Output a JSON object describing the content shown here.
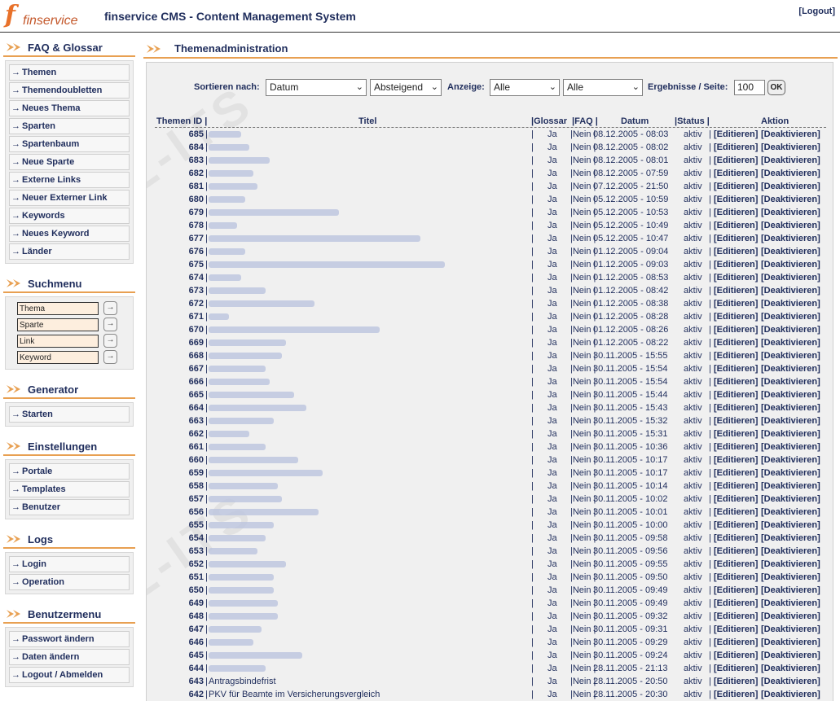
{
  "header": {
    "logo_mark": "f",
    "logo_text": "finservice",
    "app_title": "finservice CMS - Content Management System",
    "logout_label": "[Logout]"
  },
  "sidebar": {
    "faq": {
      "title": "FAQ & Glossar",
      "items": [
        "Themen",
        "Themendoubletten",
        "Neues Thema",
        "Sparten",
        "Spartenbaum",
        "Neue Sparte",
        "Externe Links",
        "Neuer Externer Link",
        "Keywords",
        "Neues Keyword",
        "Länder"
      ]
    },
    "search": {
      "title": "Suchmenu",
      "fields": [
        "Thema",
        "Sparte",
        "Link",
        "Keyword"
      ],
      "go_label": "→"
    },
    "generator": {
      "title": "Generator",
      "items": [
        "Starten"
      ]
    },
    "settings": {
      "title": "Einstellungen",
      "items": [
        "Portale",
        "Templates",
        "Benutzer"
      ]
    },
    "logs": {
      "title": "Logs",
      "items": [
        "Login",
        "Operation"
      ]
    },
    "user": {
      "title": "Benutzermenu",
      "items": [
        "Passwort ändern",
        "Daten ändern",
        "Logout / Abmelden"
      ]
    }
  },
  "main": {
    "title": "Themenadministration",
    "filter": {
      "sort_label": "Sortieren nach:",
      "sort_value": "Datum",
      "order_value": "Absteigend",
      "display_label": "Anzeige:",
      "display_value_1": "Alle",
      "display_value_2": "Alle",
      "results_label": "Ergebnisse / Seite:",
      "results_value": "100",
      "ok_label": "OK"
    },
    "columns": {
      "id": "Themen ID |",
      "title": "Titel",
      "glossar": "|Glossar",
      "faq": "|FAQ |",
      "datum": "Datum",
      "status": "|Status |",
      "aktion": "Aktion"
    },
    "rows": [
      {
        "id": "685",
        "title": "",
        "glossar": "Ja",
        "datum": "08.12.2005 - 08:03",
        "status": "aktiv"
      },
      {
        "id": "684",
        "title": "",
        "glossar": "Ja",
        "datum": "08.12.2005 - 08:02",
        "status": "aktiv"
      },
      {
        "id": "683",
        "title": "",
        "glossar": "Ja",
        "datum": "08.12.2005 - 08:01",
        "status": "aktiv"
      },
      {
        "id": "682",
        "title": "",
        "glossar": "Ja",
        "datum": "08.12.2005 - 07:59",
        "status": "aktiv"
      },
      {
        "id": "681",
        "title": "",
        "glossar": "Ja",
        "datum": "07.12.2005 - 21:50",
        "status": "aktiv"
      },
      {
        "id": "680",
        "title": "",
        "glossar": "Ja",
        "datum": "05.12.2005 - 10:59",
        "status": "aktiv"
      },
      {
        "id": "679",
        "title": "",
        "glossar": "Ja",
        "datum": "05.12.2005 - 10:53",
        "status": "aktiv"
      },
      {
        "id": "678",
        "title": "",
        "glossar": "Ja",
        "datum": "05.12.2005 - 10:49",
        "status": "aktiv"
      },
      {
        "id": "677",
        "title": "",
        "glossar": "Ja",
        "datum": "05.12.2005 - 10:47",
        "status": "aktiv"
      },
      {
        "id": "676",
        "title": "",
        "glossar": "Ja",
        "datum": "01.12.2005 - 09:04",
        "status": "aktiv"
      },
      {
        "id": "675",
        "title": "",
        "glossar": "Ja",
        "datum": "01.12.2005 - 09:03",
        "status": "aktiv"
      },
      {
        "id": "674",
        "title": "",
        "glossar": "Ja",
        "datum": "01.12.2005 - 08:53",
        "status": "aktiv"
      },
      {
        "id": "673",
        "title": "",
        "glossar": "Ja",
        "datum": "01.12.2005 - 08:42",
        "status": "aktiv"
      },
      {
        "id": "672",
        "title": "",
        "glossar": "Ja",
        "datum": "01.12.2005 - 08:38",
        "status": "aktiv"
      },
      {
        "id": "671",
        "title": "",
        "glossar": "Ja",
        "datum": "01.12.2005 - 08:28",
        "status": "aktiv"
      },
      {
        "id": "670",
        "title": "",
        "glossar": "Ja",
        "datum": "01.12.2005 - 08:26",
        "status": "aktiv"
      },
      {
        "id": "669",
        "title": "",
        "glossar": "Ja",
        "datum": "01.12.2005 - 08:22",
        "status": "aktiv"
      },
      {
        "id": "668",
        "title": "",
        "glossar": "Ja",
        "datum": "30.11.2005 - 15:55",
        "status": "aktiv"
      },
      {
        "id": "667",
        "title": "",
        "glossar": "Ja",
        "datum": "30.11.2005 - 15:54",
        "status": "aktiv"
      },
      {
        "id": "666",
        "title": "",
        "glossar": "Ja",
        "datum": "30.11.2005 - 15:54",
        "status": "aktiv"
      },
      {
        "id": "665",
        "title": "",
        "glossar": "Ja",
        "datum": "30.11.2005 - 15:44",
        "status": "aktiv"
      },
      {
        "id": "664",
        "title": "",
        "glossar": "Ja",
        "datum": "30.11.2005 - 15:43",
        "status": "aktiv"
      },
      {
        "id": "663",
        "title": "",
        "glossar": "Ja",
        "datum": "30.11.2005 - 15:32",
        "status": "aktiv"
      },
      {
        "id": "662",
        "title": "",
        "glossar": "Ja",
        "datum": "30.11.2005 - 15:31",
        "status": "aktiv"
      },
      {
        "id": "661",
        "title": "",
        "glossar": "Ja",
        "datum": "30.11.2005 - 10:36",
        "status": "aktiv"
      },
      {
        "id": "660",
        "title": "",
        "glossar": "Ja",
        "datum": "30.11.2005 - 10:17",
        "status": "aktiv"
      },
      {
        "id": "659",
        "title": "",
        "glossar": "Ja",
        "datum": "30.11.2005 - 10:17",
        "status": "aktiv"
      },
      {
        "id": "658",
        "title": "",
        "glossar": "Ja",
        "datum": "30.11.2005 - 10:14",
        "status": "aktiv"
      },
      {
        "id": "657",
        "title": "",
        "glossar": "Ja",
        "datum": "30.11.2005 - 10:02",
        "status": "aktiv"
      },
      {
        "id": "656",
        "title": "",
        "glossar": "Ja",
        "datum": "30.11.2005 - 10:01",
        "status": "aktiv"
      },
      {
        "id": "655",
        "title": "",
        "glossar": "Ja",
        "datum": "30.11.2005 - 10:00",
        "status": "aktiv"
      },
      {
        "id": "654",
        "title": "",
        "glossar": "Ja",
        "datum": "30.11.2005 - 09:58",
        "status": "aktiv"
      },
      {
        "id": "653",
        "title": "",
        "glossar": "Ja",
        "datum": "30.11.2005 - 09:56",
        "status": "aktiv"
      },
      {
        "id": "652",
        "title": "",
        "glossar": "Ja",
        "datum": "30.11.2005 - 09:55",
        "status": "aktiv"
      },
      {
        "id": "651",
        "title": "",
        "glossar": "Ja",
        "datum": "30.11.2005 - 09:50",
        "status": "aktiv"
      },
      {
        "id": "650",
        "title": "",
        "glossar": "Ja",
        "datum": "30.11.2005 - 09:49",
        "status": "aktiv"
      },
      {
        "id": "649",
        "title": "",
        "glossar": "Ja",
        "datum": "30.11.2005 - 09:49",
        "status": "aktiv"
      },
      {
        "id": "648",
        "title": "",
        "glossar": "Ja",
        "datum": "30.11.2005 - 09:32",
        "status": "aktiv"
      },
      {
        "id": "647",
        "title": "",
        "glossar": "Ja",
        "datum": "30.11.2005 - 09:31",
        "status": "aktiv"
      },
      {
        "id": "646",
        "title": "",
        "glossar": "Ja",
        "datum": "30.11.2005 - 09:29",
        "status": "aktiv"
      },
      {
        "id": "645",
        "title": "",
        "glossar": "Ja",
        "datum": "30.11.2005 - 09:24",
        "status": "aktiv"
      },
      {
        "id": "644",
        "title": "",
        "glossar": "Ja",
        "datum": "28.11.2005 - 21:13",
        "status": "aktiv"
      },
      {
        "id": "643",
        "title": "Antragsbindefrist",
        "glossar": "Ja",
        "datum": "28.11.2005 - 20:50",
        "status": "aktiv"
      },
      {
        "id": "642",
        "title": "PKV für Beamte im Versicherungsvergleich",
        "glossar": "Ja",
        "datum": "28.11.2005 - 20:30",
        "status": "aktiv"
      }
    ],
    "row_sep": "|",
    "faq_value": "|Nein |",
    "status_sep": "|",
    "edit_label": "[Editieren]",
    "deactivate_label": "[Deaktivieren]"
  },
  "colors": {
    "accent": "#e8a052",
    "text": "#1f2d5c",
    "panel": "#f0f0f0",
    "input_bg": "#fdeede"
  },
  "icons": {
    "section_arrow": "double-chevron-arrow-icon",
    "nav_arrow": "→"
  }
}
